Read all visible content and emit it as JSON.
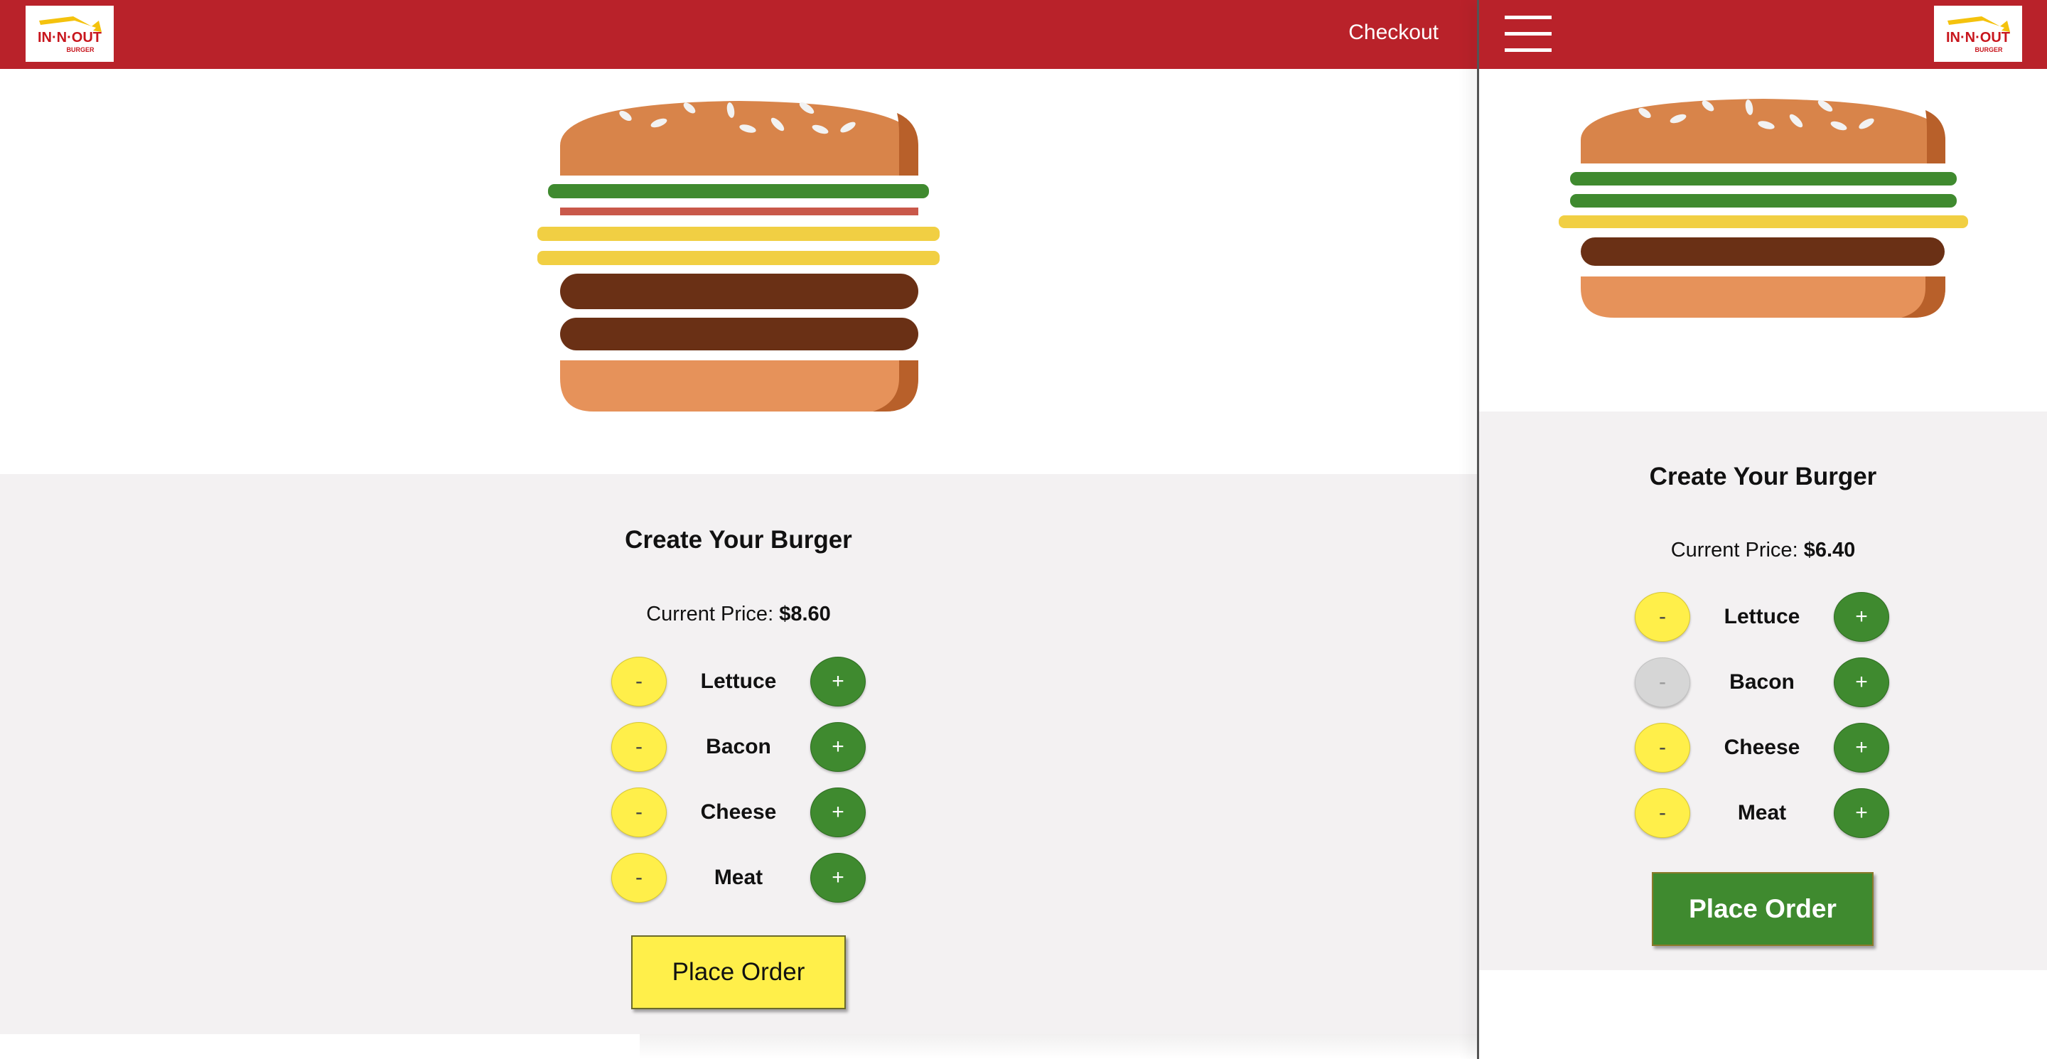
{
  "brand": {
    "name": "In-N-Out Burger",
    "logo_text": "IN·N·OUT",
    "logo_subtext": "BURGER",
    "header_color": "#b9222a",
    "logo_text_color": "#c8161d",
    "logo_arrow_color": "#f4c20d"
  },
  "desktop": {
    "nav": {
      "checkout_label": "Checkout"
    },
    "burger": {
      "layers": [
        "lettuce",
        "bacon",
        "cheese",
        "cheese",
        "meat",
        "meat"
      ],
      "counts": {
        "lettuce": 1,
        "bacon": 1,
        "cheese": 2,
        "meat": 2
      }
    },
    "builder": {
      "title": "Create Your Burger",
      "price_label": "Current Price:",
      "price_value": "$8.60",
      "controls": [
        {
          "label": "Lettuce",
          "less": "-",
          "more": "+",
          "less_disabled": false
        },
        {
          "label": "Bacon",
          "less": "-",
          "more": "+",
          "less_disabled": false
        },
        {
          "label": "Cheese",
          "less": "-",
          "more": "+",
          "less_disabled": false
        },
        {
          "label": "Meat",
          "less": "-",
          "more": "+",
          "less_disabled": false
        }
      ],
      "order_button": "Place Order"
    }
  },
  "mobile": {
    "nav": {
      "menu_icon": "hamburger-menu-icon"
    },
    "burger": {
      "layers": [
        "lettuce",
        "lettuce",
        "cheese",
        "meat"
      ],
      "counts": {
        "lettuce": 2,
        "bacon": 0,
        "cheese": 1,
        "meat": 1
      }
    },
    "builder": {
      "title": "Create Your Burger",
      "price_label": "Current Price:",
      "price_value": "$6.40",
      "controls": [
        {
          "label": "Lettuce",
          "less": "-",
          "more": "+",
          "less_disabled": false
        },
        {
          "label": "Bacon",
          "less": "-",
          "more": "+",
          "less_disabled": true
        },
        {
          "label": "Cheese",
          "less": "-",
          "more": "+",
          "less_disabled": false
        },
        {
          "label": "Meat",
          "less": "-",
          "more": "+",
          "less_disabled": false
        }
      ],
      "order_button": "Place Order"
    }
  },
  "colors": {
    "bun": "#d8844a",
    "bun_shadow": "#b8602a",
    "bottom_bun": "#e6925a",
    "lettuce": "#3f8a2f",
    "bacon": "#c9584a",
    "cheese": "#f1cf43",
    "meat": "#6a3015",
    "seed": "#f2f2f2",
    "less_button": "#ffef4a",
    "more_button": "#3f8a2f",
    "panel_bg": "#f3f1f2"
  }
}
